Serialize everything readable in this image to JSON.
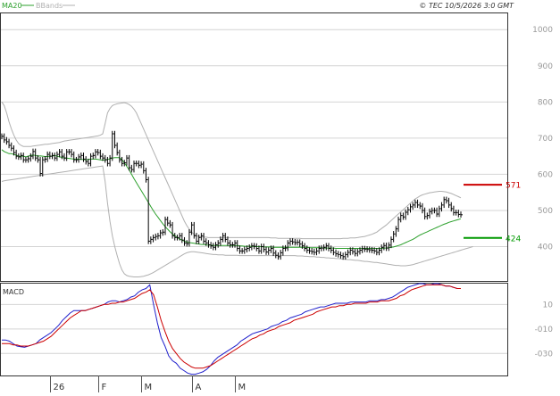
{
  "header": {
    "indicators": [
      {
        "label": "MA20",
        "color": "#2ca02c"
      },
      {
        "label": "BBands",
        "color": "#b0b0b0"
      }
    ],
    "copyright": "© TEC 10/5/2026 3:0 GMT"
  },
  "chart_data": [
    {
      "type": "ohlc",
      "panel": "price",
      "y_ticks": [
        400,
        500,
        600,
        700,
        800,
        900,
        1000
      ],
      "ylim": [
        305,
        1045
      ],
      "grid": true,
      "x_labels": [
        {
          "label": "26",
          "index": 20
        },
        {
          "label": "F",
          "index": 40
        },
        {
          "label": "M",
          "index": 58
        },
        {
          "label": "A",
          "index": 79
        },
        {
          "label": "M",
          "index": 97
        }
      ],
      "series": [
        {
          "name": "price",
          "color": "#000000",
          "values": [
            705,
            695,
            690,
            680,
            672,
            660,
            650,
            648,
            652,
            640,
            640,
            643,
            650,
            663,
            645,
            640,
            602,
            640,
            642,
            655,
            650,
            652,
            645,
            655,
            662,
            650,
            645,
            662,
            662,
            655,
            640,
            640,
            648,
            652,
            642,
            635,
            630,
            650,
            652,
            662,
            660,
            650,
            645,
            640,
            630,
            645,
            712,
            680,
            660,
            640,
            630,
            632,
            645,
            618,
            613,
            630,
            630,
            625,
            628,
            610,
            585,
            415,
            420,
            425,
            428,
            430,
            438,
            440,
            475,
            465,
            460,
            430,
            425,
            425,
            430,
            418,
            410,
            408,
            440,
            460,
            430,
            415,
            425,
            430,
            415,
            410,
            405,
            402,
            398,
            405,
            410,
            420,
            430,
            420,
            410,
            405,
            405,
            410,
            395,
            388,
            388,
            392,
            395,
            398,
            402,
            401,
            395,
            388,
            400,
            392,
            385,
            390,
            395,
            382,
            376,
            372,
            383,
            395,
            396,
            410,
            415,
            413,
            411,
            412,
            407,
            402,
            395,
            390,
            388,
            386,
            384,
            388,
            395,
            396,
            398,
            402,
            395,
            390,
            384,
            380,
            378,
            375,
            372,
            378,
            384,
            390,
            386,
            381,
            386,
            390,
            394,
            393,
            392,
            391,
            390,
            388,
            384,
            390,
            398,
            403,
            396,
            404,
            420,
            435,
            449,
            475,
            486,
            482,
            495,
            502,
            510,
            515,
            522,
            515,
            512,
            500,
            483,
            486,
            497,
            500,
            500,
            490,
            505,
            515,
            530,
            527,
            515,
            505,
            494,
            494,
            489,
            488
          ]
        },
        {
          "name": "MA20",
          "color": "#2ca02c",
          "values": [
            668,
            663,
            660,
            657,
            657,
            655,
            653,
            650,
            650,
            650,
            648,
            650,
            652,
            653,
            652,
            650,
            651,
            650,
            649,
            649,
            650,
            650,
            652,
            650,
            648,
            647,
            645,
            645,
            644,
            643,
            642,
            642,
            642,
            641,
            641,
            640,
            641,
            642,
            642,
            642,
            641,
            640,
            639,
            640,
            641,
            643,
            645,
            646,
            646,
            646,
            640,
            632,
            622,
            612,
            600,
            588,
            577,
            566,
            555,
            544,
            533,
            522,
            511,
            500,
            490,
            481,
            472,
            463,
            455,
            448,
            441,
            435,
            430,
            425,
            421,
            418,
            415,
            413,
            411,
            410,
            409,
            408,
            407,
            406,
            406,
            405,
            404,
            404,
            403,
            403,
            403,
            403,
            403,
            403,
            403,
            403,
            403,
            403,
            403,
            402,
            402,
            401,
            401,
            401,
            401,
            400,
            400,
            400,
            400,
            399,
            399,
            399,
            399,
            398,
            398,
            398,
            398,
            398,
            398,
            398,
            398,
            398,
            398,
            398,
            398,
            398,
            398,
            398,
            397,
            397,
            397,
            397,
            397,
            397,
            396,
            396,
            396,
            396,
            396,
            395,
            395,
            395,
            395,
            395,
            395,
            395,
            395,
            395,
            395,
            395,
            395,
            395,
            395,
            395,
            395,
            395,
            395,
            395,
            395,
            396,
            396,
            397,
            398,
            399,
            401,
            403,
            405,
            408,
            411,
            414,
            417,
            420,
            424,
            428,
            432,
            435,
            438,
            441,
            444,
            447,
            450,
            453,
            456,
            459,
            462,
            464,
            467,
            469,
            471,
            473,
            475,
            477
          ]
        },
        {
          "name": "BB upper",
          "color": "#b0b0b0",
          "values": [
            800,
            790,
            770,
            745,
            725,
            708,
            695,
            685,
            680,
            677,
            677,
            677,
            677,
            678,
            679,
            680,
            681,
            682,
            683,
            683,
            684,
            685,
            686,
            687,
            688,
            690,
            692,
            693,
            694,
            695,
            696,
            697,
            698,
            699,
            700,
            701,
            702,
            703,
            704,
            705,
            706,
            708,
            712,
            740,
            770,
            782,
            790,
            793,
            795,
            796,
            797,
            798,
            796,
            793,
            788,
            780,
            770,
            755,
            740,
            725,
            710,
            695,
            680,
            665,
            650,
            635,
            620,
            605,
            590,
            575,
            560,
            545,
            530,
            515,
            500,
            485,
            470,
            458,
            448,
            440,
            434,
            430,
            428,
            427,
            426,
            426,
            425,
            425,
            425,
            425,
            425,
            425,
            425,
            425,
            425,
            425,
            425,
            425,
            425,
            425,
            425,
            425,
            425,
            425,
            425,
            425,
            425,
            425,
            425,
            425,
            425,
            425,
            424,
            424,
            424,
            423,
            423,
            423,
            423,
            423,
            423,
            423,
            423,
            423,
            423,
            422,
            422,
            422,
            422,
            422,
            422,
            422,
            422,
            422,
            422,
            422,
            422,
            422,
            422,
            422,
            422,
            422,
            423,
            423,
            423,
            424,
            424,
            424,
            425,
            426,
            427,
            428,
            430,
            432,
            434,
            437,
            440,
            445,
            450,
            455,
            460,
            466,
            472,
            478,
            484,
            490,
            496,
            502,
            508,
            514,
            520,
            526,
            532,
            536,
            540,
            543,
            545,
            547,
            549,
            550,
            551,
            552,
            553,
            553,
            552,
            551,
            549,
            547,
            544,
            541,
            538,
            535
          ]
        },
        {
          "name": "BB lower",
          "color": "#b0b0b0",
          "values": [
            580,
            582,
            583,
            584,
            585,
            586,
            587,
            588,
            589,
            590,
            591,
            592,
            593,
            594,
            595,
            596,
            597,
            598,
            599,
            600,
            601,
            602,
            603,
            604,
            605,
            606,
            607,
            608,
            609,
            610,
            611,
            612,
            613,
            614,
            615,
            616,
            617,
            618,
            619,
            620,
            621,
            622,
            623,
            580,
            520,
            470,
            430,
            400,
            375,
            352,
            335,
            325,
            320,
            318,
            317,
            316,
            316,
            316,
            317,
            318,
            320,
            322,
            325,
            328,
            332,
            336,
            340,
            344,
            348,
            352,
            356,
            360,
            364,
            368,
            372,
            376,
            380,
            383,
            385,
            386,
            386,
            385,
            384,
            383,
            382,
            381,
            380,
            379,
            378,
            378,
            377,
            377,
            377,
            376,
            376,
            376,
            376,
            376,
            376,
            375,
            375,
            375,
            375,
            375,
            375,
            375,
            375,
            375,
            375,
            375,
            375,
            375,
            375,
            375,
            375,
            375,
            375,
            375,
            375,
            375,
            375,
            375,
            375,
            374,
            374,
            374,
            373,
            373,
            372,
            372,
            372,
            371,
            371,
            370,
            370,
            369,
            369,
            368,
            368,
            367,
            367,
            366,
            365,
            365,
            364,
            364,
            363,
            362,
            362,
            361,
            360,
            359,
            359,
            358,
            357,
            356,
            356,
            355,
            354,
            353,
            352,
            351,
            350,
            349,
            348,
            348,
            347,
            347,
            347,
            348,
            349,
            350,
            352,
            354,
            356,
            358,
            360,
            362,
            364,
            366,
            368,
            370,
            372,
            374,
            376,
            378,
            380,
            382,
            384,
            386,
            388,
            390,
            392,
            394,
            396,
            398,
            400
          ]
        }
      ],
      "annotations": [
        {
          "label": "571",
          "value": 571,
          "color": "#cc0000"
        },
        {
          "label": "424",
          "value": 424,
          "color": "#009900"
        }
      ]
    },
    {
      "type": "line",
      "panel": "indicator",
      "title": "MACD",
      "y_ticks": [
        10,
        -10,
        -30
      ],
      "y_tick_labels": [
        "10",
        "-010",
        "-030"
      ],
      "ylim": [
        -48,
        27
      ],
      "grid": true,
      "series": [
        {
          "name": "MACD",
          "color": "#2020cc",
          "values": [
            -19,
            -19,
            -20,
            -22,
            -24,
            -24.5,
            -25,
            -24,
            -23,
            -22,
            -19,
            -17,
            -15,
            -13,
            -10,
            -7,
            -3,
            0,
            3,
            5,
            5,
            5,
            5,
            6,
            7,
            8,
            9,
            10,
            12,
            13,
            13,
            12,
            13,
            14,
            16,
            17,
            20,
            22,
            23,
            26,
            10,
            -5,
            -17,
            -24,
            -32,
            -36,
            -38,
            -42,
            -44,
            -46,
            -47,
            -47,
            -46,
            -45,
            -43,
            -40,
            -36,
            -33,
            -31,
            -29,
            -27,
            -25,
            -23,
            -20,
            -18,
            -16,
            -14,
            -13,
            -12,
            -11,
            -10,
            -8,
            -7,
            -6,
            -4,
            -3,
            -1,
            0,
            1,
            2,
            4,
            5,
            6,
            7,
            8,
            8,
            9,
            10,
            11,
            11,
            11,
            11,
            12,
            12,
            12,
            12,
            12,
            13,
            13,
            13,
            14,
            14,
            15,
            16,
            18,
            20,
            22,
            24,
            25,
            26,
            27,
            27,
            26,
            26,
            27,
            27,
            26,
            25,
            25,
            24,
            23,
            23
          ]
        },
        {
          "name": "Signal",
          "color": "#cc0000",
          "values": [
            -22,
            -22,
            -22,
            -23,
            -23,
            -24,
            -24,
            -24,
            -23,
            -22,
            -21,
            -20,
            -18,
            -16,
            -13,
            -10,
            -7,
            -4,
            -1,
            1,
            3,
            5,
            5,
            6,
            7,
            8,
            9,
            10,
            10,
            11,
            11,
            12,
            12,
            13,
            14,
            15,
            17,
            19,
            20,
            22,
            18,
            8,
            -3,
            -12,
            -20,
            -26,
            -30,
            -34,
            -37,
            -39,
            -41,
            -42,
            -42,
            -42,
            -41,
            -40,
            -38,
            -36,
            -34,
            -32,
            -30,
            -28,
            -26,
            -24,
            -22,
            -20,
            -18,
            -17,
            -15,
            -14,
            -12,
            -11,
            -10,
            -8,
            -7,
            -6,
            -5,
            -3,
            -2,
            -1,
            0,
            1,
            2,
            4,
            5,
            6,
            7,
            8,
            8,
            9,
            9,
            10,
            10,
            11,
            11,
            11,
            11,
            12,
            12,
            12,
            13,
            13,
            13,
            14,
            15,
            17,
            18,
            20,
            22,
            23,
            24,
            25,
            26,
            26,
            26,
            26,
            26,
            25,
            25,
            24,
            23,
            23
          ]
        }
      ]
    }
  ]
}
